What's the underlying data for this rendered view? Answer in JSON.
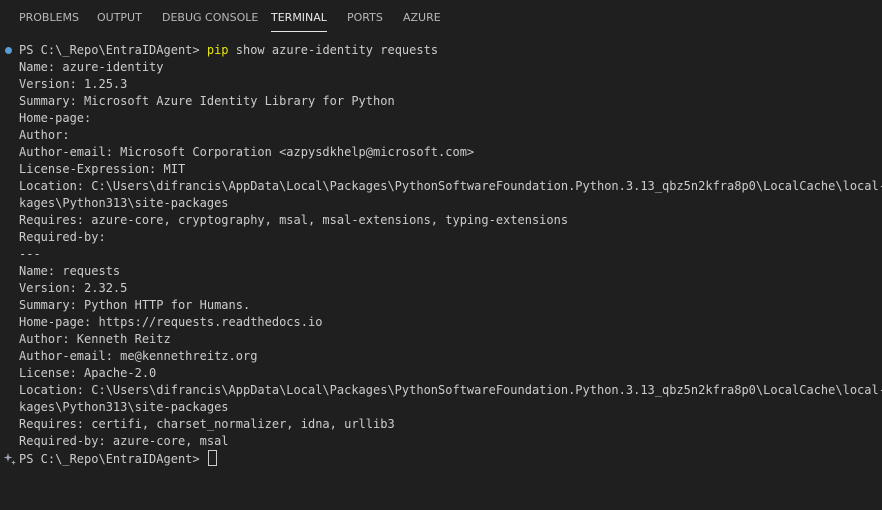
{
  "tabs": [
    {
      "label": "PROBLEMS",
      "active": false
    },
    {
      "label": "OUTPUT",
      "active": false
    },
    {
      "label": "DEBUG CONSOLE",
      "active": false
    },
    {
      "label": "TERMINAL",
      "active": true
    },
    {
      "label": "PORTS",
      "active": false
    },
    {
      "label": "AZURE",
      "active": false
    }
  ],
  "colors": {
    "background": "#1f1f1f",
    "text": "#cccccc",
    "command_highlight": "#e5e510",
    "prompt_dot": "#5b9bd5"
  },
  "terminal": {
    "prompt": "PS C:\\_Repo\\EntraIDAgent> ",
    "command_name": "pip",
    "command_args": " show azure-identity requests",
    "output_lines": [
      "Name: azure-identity",
      "Version: 1.25.3",
      "Summary: Microsoft Azure Identity Library for Python",
      "Home-page:",
      "Author:",
      "Author-email: Microsoft Corporation <azpysdkhelp@microsoft.com>",
      "License-Expression: MIT",
      "Location: C:\\Users\\difrancis\\AppData\\Local\\Packages\\PythonSoftwareFoundation.Python.3.13_qbz5n2kfra8p0\\LocalCache\\local-pac",
      "kages\\Python313\\site-packages",
      "Requires: azure-core, cryptography, msal, msal-extensions, typing-extensions",
      "Required-by:",
      "---",
      "Name: requests",
      "Version: 2.32.5",
      "Summary: Python HTTP for Humans.",
      "Home-page: https://requests.readthedocs.io",
      "Author: Kenneth Reitz",
      "Author-email: me@kennethreitz.org",
      "License: Apache-2.0",
      "Location: C:\\Users\\difrancis\\AppData\\Local\\Packages\\PythonSoftwareFoundation.Python.3.13_qbz5n2kfra8p0\\LocalCache\\local-pac",
      "kages\\Python313\\site-packages",
      "Requires: certifi, charset_normalizer, idna, urllib3",
      "Required-by: azure-core, msal"
    ],
    "final_prompt": "PS C:\\_Repo\\EntraIDAgent> "
  }
}
